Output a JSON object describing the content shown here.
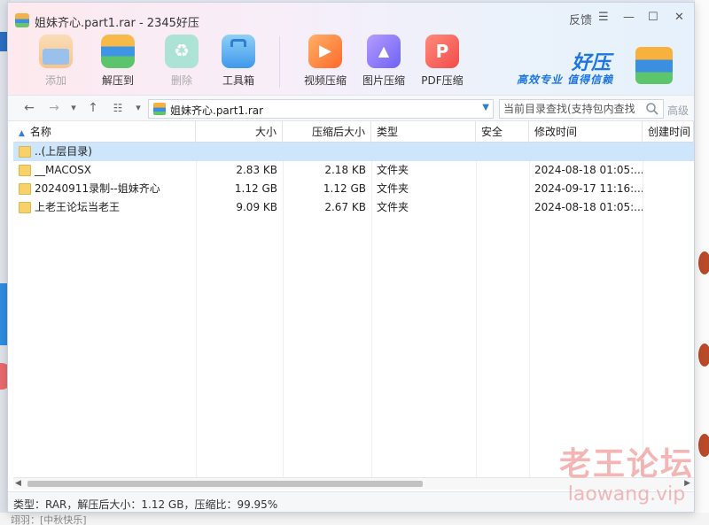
{
  "window": {
    "title": "姐妹齐心.part1.rar - 2345好压",
    "feedback_label": "反馈"
  },
  "toolbar": {
    "items": [
      {
        "label": "添加",
        "icon": "add-icon",
        "enabled": false
      },
      {
        "label": "解压到",
        "icon": "extract-icon",
        "enabled": true
      },
      {
        "label": "删除",
        "icon": "delete-icon",
        "enabled": false
      },
      {
        "label": "工具箱",
        "icon": "toolbox-icon",
        "enabled": true
      },
      {
        "label": "视频压缩",
        "icon": "video-compress-icon",
        "enabled": true
      },
      {
        "label": "图片压缩",
        "icon": "image-compress-icon",
        "enabled": true
      },
      {
        "label": "PDF压缩",
        "icon": "pdf-compress-icon",
        "enabled": true
      }
    ]
  },
  "brand": {
    "name": "好压",
    "slogan": "高效专业 值得信赖"
  },
  "address": {
    "path": "姐妹齐心.part1.rar",
    "search_placeholder": "当前目录查找(支持包内查找)",
    "advanced_label": "高级"
  },
  "table": {
    "columns": [
      "名称",
      "大小",
      "压缩后大小",
      "类型",
      "安全",
      "修改时间",
      "创建时间"
    ],
    "rows": [
      {
        "name": "..(上层目录)",
        "size": "",
        "packed": "",
        "type": "",
        "safe": "",
        "modified": "",
        "created": "",
        "selected": true
      },
      {
        "name": "__MACOSX",
        "size": "2.83 KB",
        "packed": "2.18 KB",
        "type": "文件夹",
        "safe": "",
        "modified": "2024-08-18 01:05:...",
        "created": ""
      },
      {
        "name": "20240911录制--姐妹齐心",
        "size": "1.12 GB",
        "packed": "1.12 GB",
        "type": "文件夹",
        "safe": "",
        "modified": "2024-09-17 11:16:...",
        "created": ""
      },
      {
        "name": "上老王论坛当老王",
        "size": "9.09 KB",
        "packed": "2.67 KB",
        "type": "文件夹",
        "safe": "",
        "modified": "2024-08-18 01:05:...",
        "created": ""
      }
    ]
  },
  "status": {
    "text": "类型：RAR，解压后大小：1.12 GB，压缩比：99.95%"
  },
  "watermark": {
    "main": "老王论坛",
    "sub": "laowang.vip"
  },
  "background_app": {
    "bottom_text": "翊羽：[中秋快乐]"
  },
  "colors": {
    "accent": "#1f76e0",
    "selection": "#cde6fb",
    "folder": "#f7d26b"
  }
}
